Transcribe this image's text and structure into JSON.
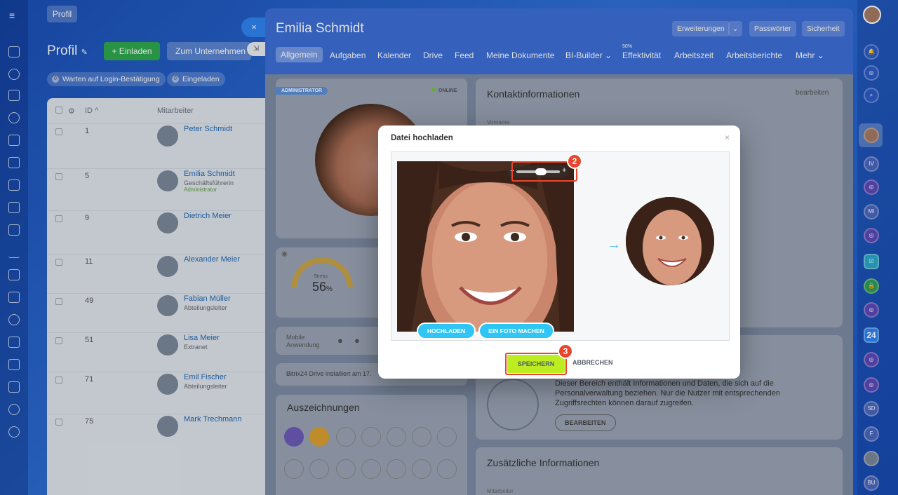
{
  "top_button": "Profil",
  "list": {
    "title": "Profil",
    "invite_label": "+ Einladen",
    "company_label": "Zum Unternehmen h",
    "filters": [
      {
        "count": "0",
        "label": "Warten auf Login-Bestätigung"
      },
      {
        "count": "0",
        "label": "Eingeladen"
      }
    ],
    "headers": {
      "id": "ID ^",
      "employee": "Mitarbeiter"
    },
    "rows": [
      {
        "id": "1",
        "name": "Peter Schmidt",
        "role": "",
        "status": ""
      },
      {
        "id": "5",
        "name": "Emilia Schmidt",
        "role": "Geschäftsführerin",
        "status": "Administrator"
      },
      {
        "id": "9",
        "name": "Dietrich Meier",
        "role": "",
        "status": ""
      },
      {
        "id": "11",
        "name": "Alexander Meier",
        "role": "",
        "status": ""
      },
      {
        "id": "49",
        "name": "Fabian Müller",
        "role": "Abteilungsleiter",
        "status": ""
      },
      {
        "id": "51",
        "name": "Lisa Meier",
        "role": "Extranet",
        "status": ""
      },
      {
        "id": "71",
        "name": "Emil Fischer",
        "role": "Abteilungsleiter",
        "status": ""
      },
      {
        "id": "75",
        "name": "Mark Trechmann",
        "role": "",
        "status": ""
      }
    ]
  },
  "slider": {
    "close_symbol": "×",
    "title": "Emilia Schmidt",
    "header_buttons": [
      "Erweiterungen",
      "Passwörter",
      "Sicherheit"
    ],
    "tabs": [
      "Allgemein",
      "Aufgaben",
      "Kalender",
      "Drive",
      "Feed",
      "Meine Dokumente",
      "BI-Builder ⌄",
      "Effektivität",
      "Arbeitszeit",
      "Arbeitsberichte",
      "Mehr ⌄"
    ],
    "tab_sup": "50%",
    "admin_badge": "ADMINISTRATOR",
    "online": "ONLINE",
    "contact_title": "Kontaktinformationen",
    "edit_link": "bearbeiten",
    "first_name_label": "Vorname",
    "stress_label": "Stress",
    "stress_value": "56",
    "stress_unit": "%",
    "mobile_label": "Mobile Anwendung",
    "drive_text": "Bitrix24 Drive installiert am 17.",
    "awards_title": "Auszeichnungen",
    "hr_text": "Dieser Bereich enthält Informationen und Daten, die sich auf die Personalverwaltung beziehen. Nur die Nutzer mit entsprechenden Zugriffsrechten können darauf zugreifen.",
    "hr_button": "BEARBEITEN",
    "extra_title": "Zusätzliche Informationen",
    "extra_label": "Mitarbeiter"
  },
  "right_rail": [
    "IV",
    "MI",
    "24",
    "SD",
    "F",
    "BU"
  ],
  "dialog": {
    "title": "Datei hochladen",
    "close": "×",
    "upload_label": "HOCHLADEN",
    "photo_label": "EIN FOTO MACHEN",
    "save_label": "SPEICHERN",
    "cancel_label": "ABBRECHEN",
    "zoom_minus": "−",
    "zoom_plus": "+",
    "arrow": "→",
    "step_2": "2",
    "step_3": "3"
  },
  "colors": {
    "accent": "#2fc6f6",
    "save": "#bbed21",
    "highlight": "#e8452c"
  }
}
